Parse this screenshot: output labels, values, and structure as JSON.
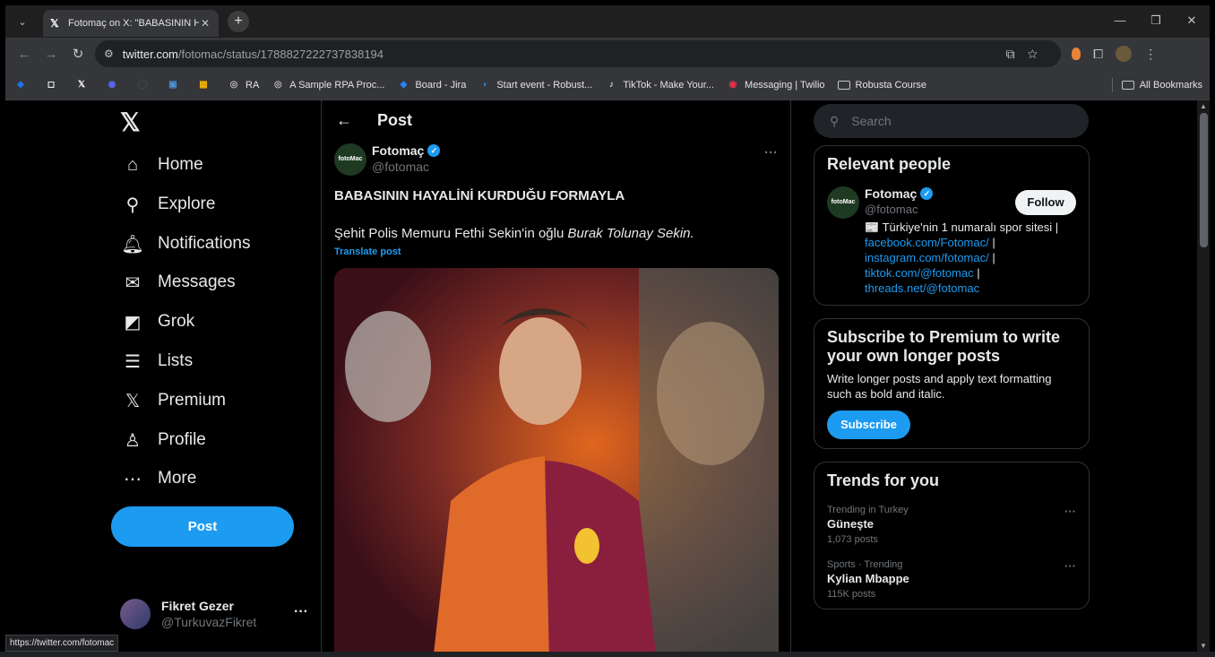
{
  "browser": {
    "tab_title": "Fotomaç on X: \"BABASININ HAYALİNİ KURDUĞU FORMAYLA\"",
    "tab_favicon": "𝕏",
    "url_host": "twitter.com",
    "url_path": "/fotomac/status/1788827222737838194",
    "bookmarks": [
      {
        "label": "",
        "icon": "◆",
        "color": "#1a73e8"
      },
      {
        "label": "",
        "icon": "◻",
        "color": "#ffffff"
      },
      {
        "label": "",
        "icon": "𝕏",
        "color": "#ffffff"
      },
      {
        "label": "",
        "icon": "◉",
        "color": "#5b6cff"
      },
      {
        "label": "",
        "icon": "◯",
        "color": "#444444"
      },
      {
        "label": "",
        "icon": "▣",
        "color": "#4a90d9"
      },
      {
        "label": "",
        "icon": "▦",
        "color": "#f4b400"
      },
      {
        "label": "RA",
        "icon": "◎",
        "color": "#bbbbbb"
      },
      {
        "label": "A Sample RPA Proc...",
        "icon": "◎",
        "color": "#bbbbbb"
      },
      {
        "label": "Board - Jira",
        "icon": "◆",
        "color": "#2684ff"
      },
      {
        "label": "Start event - Robust...",
        "icon": "◗",
        "color": "#1e88e5"
      },
      {
        "label": "TikTok - Make Your...",
        "icon": "♪",
        "color": "#ffffff"
      },
      {
        "label": "Messaging | Twilio",
        "icon": "◉",
        "color": "#f22f46"
      },
      {
        "label": "Robusta Course",
        "icon": "folder",
        "color": "#c4c7c5"
      }
    ],
    "all_bookmarks": "All Bookmarks",
    "status_url": "https://twitter.com/fotomac"
  },
  "nav": {
    "items": [
      {
        "label": "Home",
        "icon": "⌂"
      },
      {
        "label": "Explore",
        "icon": "⚲"
      },
      {
        "label": "Notifications",
        "icon": "🔔︎"
      },
      {
        "label": "Messages",
        "icon": "✉"
      },
      {
        "label": "Grok",
        "icon": "◩"
      },
      {
        "label": "Lists",
        "icon": "☰"
      },
      {
        "label": "Premium",
        "icon": "𝕏"
      },
      {
        "label": "Profile",
        "icon": "♙"
      },
      {
        "label": "More",
        "icon": "⋯"
      }
    ],
    "post_label": "Post",
    "user_name": "Fikret Gezer",
    "user_handle": "@TurkuvazFikret"
  },
  "post": {
    "header": "Post",
    "author_name": "Fotomaç",
    "author_handle": "@fotomac",
    "avatar_text": "fotoMac",
    "headline": "BABASININ HAYALİNİ KURDUĞU FORMAYLA",
    "body_plain": "Şehit Polis Memuru Fethi Sekin'in oğlu ",
    "body_italic": "Burak Tolunay Sekin.",
    "translate": "Translate post"
  },
  "sidebar": {
    "search_placeholder": "Search",
    "relevant_title": "Relevant people",
    "rp_name": "Fotomaç",
    "rp_handle": "@fotomac",
    "rp_follow": "Follow",
    "rp_bio_text": "📰 Türkiye'nin 1 numaralı spor sitesi |",
    "rp_links": [
      "facebook.com/Fotomac/",
      "instagram.com/fotomac/",
      "tiktok.com/@fotomac",
      "threads.net/@fotomac"
    ],
    "premium_title": "Subscribe to Premium to write your own longer posts",
    "premium_text": "Write longer posts and apply text formatting such as bold and italic.",
    "premium_button": "Subscribe",
    "trends_title": "Trends for you",
    "trends": [
      {
        "context": "Trending in Turkey",
        "title": "Güneşte",
        "posts": "1,073 posts"
      },
      {
        "context": "Sports · Trending",
        "title": "Kylian Mbappe",
        "posts": "115K posts"
      }
    ]
  }
}
